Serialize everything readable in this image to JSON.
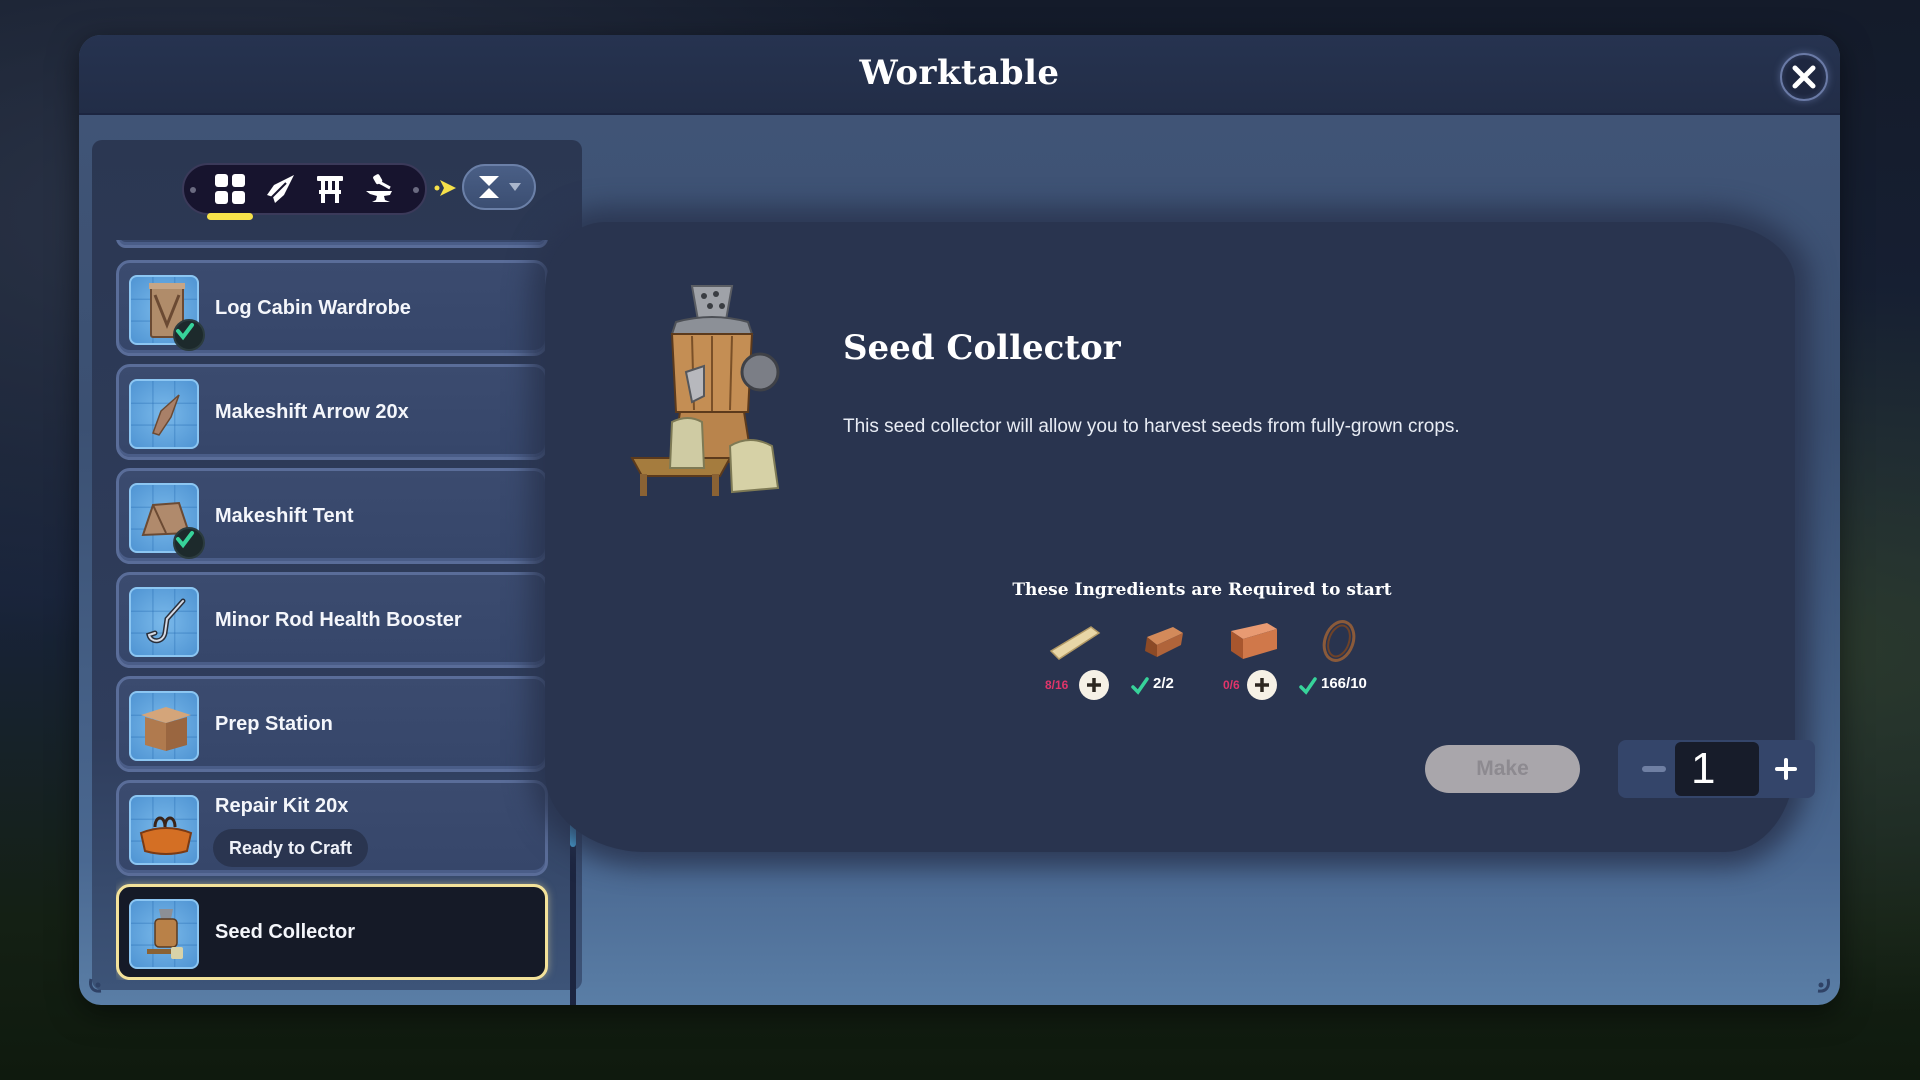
{
  "window": {
    "title": "Worktable",
    "close_icon": "close-x-icon"
  },
  "filters": {
    "tabs": [
      {
        "icon": "grid-all-icon",
        "active": true
      },
      {
        "icon": "arrowhead-icon",
        "active": false
      },
      {
        "icon": "furniture-chair-icon",
        "active": false
      },
      {
        "icon": "anvil-hammer-icon",
        "active": false
      }
    ],
    "next_icon": "chevron-right-icon",
    "sort_icon": "hourglass-sort-icon"
  },
  "recipes": [
    {
      "label": "Log Cabin Wardrobe",
      "icon": "wardrobe-icon",
      "owned": true,
      "status": null,
      "selected": false
    },
    {
      "label": "Makeshift Arrow 20x",
      "icon": "arrow-icon",
      "owned": false,
      "status": null,
      "selected": false
    },
    {
      "label": "Makeshift Tent",
      "icon": "tent-icon",
      "owned": true,
      "status": null,
      "selected": false
    },
    {
      "label": "Minor Rod Health Booster",
      "icon": "fishing-hook-icon",
      "owned": false,
      "status": null,
      "selected": false
    },
    {
      "label": "Prep Station",
      "icon": "prep-station-icon",
      "owned": false,
      "status": null,
      "selected": false
    },
    {
      "label": "Repair Kit 20x",
      "icon": "repair-kit-bag-icon",
      "owned": false,
      "status": "Ready to Craft",
      "selected": false
    },
    {
      "label": "Seed Collector",
      "icon": "seed-collector-icon",
      "owned": false,
      "status": null,
      "selected": true
    }
  ],
  "scroll": {
    "position_fraction": 0.47,
    "visible_fraction": 0.28
  },
  "detail": {
    "name": "Seed Collector",
    "description": "This seed collector will allow you to harvest seeds from fully-grown crops.",
    "ingredients_heading": "These Ingredients are Required to start",
    "ingredients": [
      {
        "icon": "wood-plank-icon",
        "have": 8,
        "need": 16,
        "count_text": "8/16",
        "sufficient": false
      },
      {
        "icon": "copper-bar-icon",
        "have": 2,
        "need": 2,
        "count_text": "2/2",
        "sufficient": true
      },
      {
        "icon": "clay-brick-icon",
        "have": 0,
        "need": 6,
        "count_text": "0/6",
        "sufficient": false
      },
      {
        "icon": "rope-coil-icon",
        "have": 166,
        "need": 10,
        "count_text": "166/10",
        "sufficient": true
      }
    ],
    "make_label": "Make",
    "make_enabled": false,
    "quantity": "1"
  },
  "colors": {
    "accent_yellow": "#f6e14a",
    "selected_border": "#f3e29a",
    "scroll_thumb": "#4fb8f0",
    "insufficient": "#e0356a",
    "sufficient_check": "#37d39a"
  }
}
